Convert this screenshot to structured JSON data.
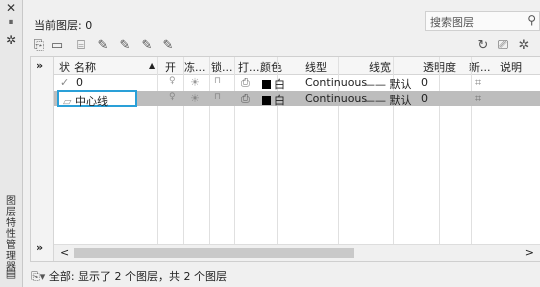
{
  "side": {
    "close": "✕",
    "pin": "⏸",
    "gear": "✲",
    "vertical_title": "图层特性管理器"
  },
  "current_layer": "当前图层: 0",
  "search": {
    "placeholder": "搜索图层",
    "icon": "search-icon"
  },
  "toolbar": {
    "left_icons": [
      "new-property-filter-icon",
      "new-group-filter-icon",
      "layer-states-manager-icon",
      "new-layer-icon",
      "new-layer-vp-frozen-icon",
      "delete-layer-icon",
      "set-current-icon"
    ],
    "right_icons": [
      "refresh-icon",
      "settings-icon",
      "gear-icon"
    ]
  },
  "tree": {
    "expand": "»",
    "expand2": "»"
  },
  "columns": [
    "状",
    "名称",
    "开",
    "冻...",
    "锁...",
    "打...",
    "颜色",
    "线型",
    "线宽",
    "透明度",
    "新...",
    "说明"
  ],
  "rows": [
    {
      "status": "✓",
      "name": "0",
      "on": "💡",
      "freeze": "☀",
      "lock": "🔓",
      "plot": "⎙",
      "color": "白",
      "linetype": "Continuous",
      "lineweight": "—— 默认",
      "transparency": "0",
      "newvp": "⌗"
    },
    {
      "status": "▱",
      "name": "中心线",
      "on": "💡",
      "freeze": "☀",
      "lock": "🔓",
      "plot": "⎙",
      "color": "白",
      "linetype": "Continuous",
      "lineweight": "—— 默认",
      "transparency": "0",
      "newvp": "⌗"
    }
  ],
  "scroll": {
    "left": "<",
    "right": ">"
  },
  "status_text": "全部: 显示了 2 个图层，共 2 个图层",
  "colors": {
    "selection_row": "#bdbdbd",
    "edit_border": "#2aa0d8"
  }
}
